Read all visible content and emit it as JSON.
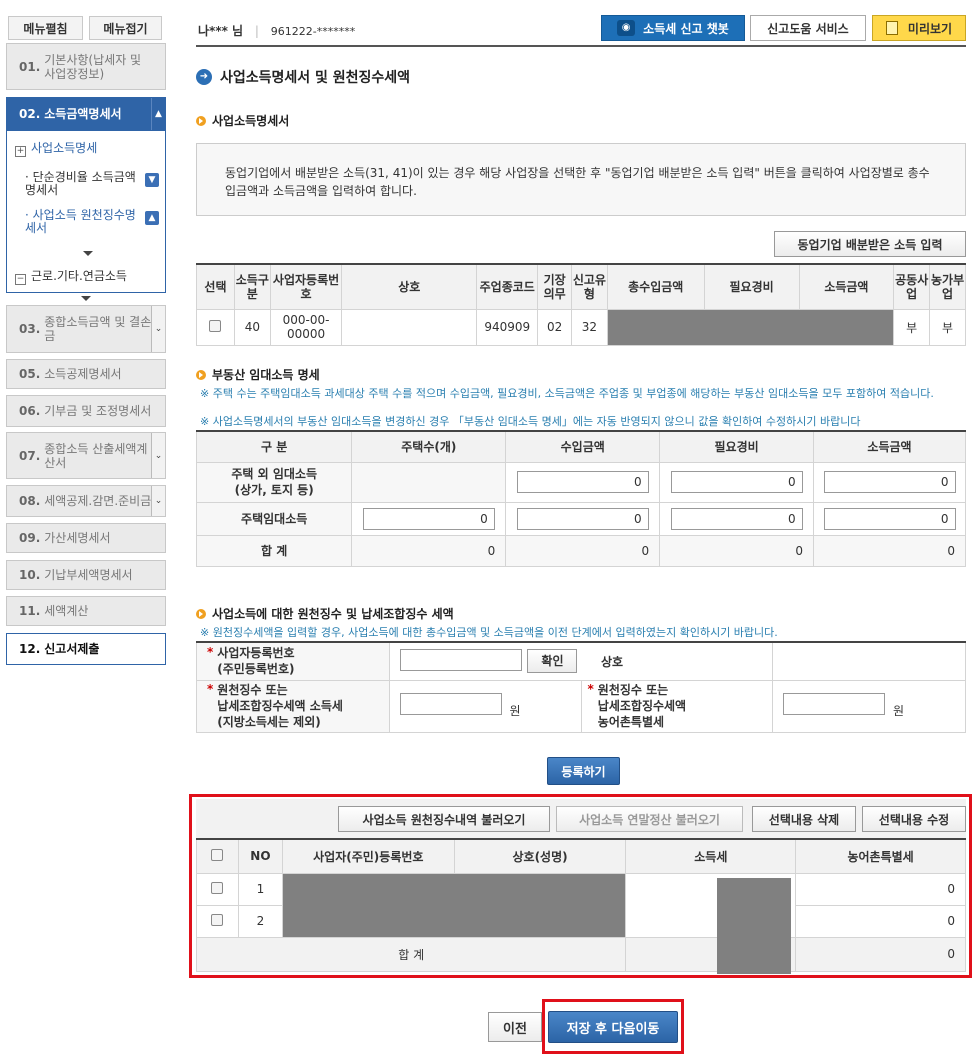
{
  "sidebar": {
    "menu_open": "메뉴펼침",
    "menu_close": "메뉴접기",
    "items": [
      {
        "num": "01.",
        "label": "기본사항(납세자 및\n사업장정보)"
      },
      {
        "num": "02.",
        "label": "소득금액명세서"
      },
      {
        "num": "03.",
        "label": "종합소득금액 및 결손금"
      },
      {
        "num": "05.",
        "label": "소득공제명세서"
      },
      {
        "num": "06.",
        "label": "기부금 및 조정명세서"
      },
      {
        "num": "07.",
        "label": "종합소득 산출세액계산서"
      },
      {
        "num": "08.",
        "label": "세액공제.감면.준비금"
      },
      {
        "num": "09.",
        "label": "가산세명세서"
      },
      {
        "num": "10.",
        "label": "기납부세액명세서"
      },
      {
        "num": "11.",
        "label": "세액계산"
      },
      {
        "num": "12.",
        "label": "신고서제출"
      }
    ],
    "sub": {
      "business": "사업소득명세",
      "simple_rate": "단순경비율 소득금액명세서",
      "withholding": "사업소득 원천징수명세서",
      "labor": "근로.기타.연금소득"
    }
  },
  "header": {
    "user_name": "나*** 님",
    "user_id": "961222-*******",
    "chatbot": "소득세 신고 챗봇",
    "help": "신고도움 서비스",
    "preview": "미리보기"
  },
  "page_title": "사업소득명세서 및 원천징수세액",
  "business": {
    "title": "사업소득명세서",
    "info": "동업기업에서 배분받은 소득(31, 41)이 있는 경우 해당 사업장을 선택한 후 \"동업기업 배분받은 소득 입력\" 버튼을 클릭하여 사업장별로 총수입금액과 소득금액을 입력하여 합니다.",
    "partner_btn": "동업기업 배분받은 소득 입력",
    "columns": [
      "선택",
      "소득구분",
      "사업자등록번호",
      "상호",
      "주업종코드",
      "기장의무",
      "신고유형",
      "총수입금액",
      "필요경비",
      "소득금액",
      "공동사업",
      "농가부업"
    ],
    "row": {
      "type": "40",
      "reg_no": "000-00-00000",
      "name": "",
      "code": "940909",
      "duty": "02",
      "report": "32",
      "joint": "부",
      "farm": "부"
    }
  },
  "rental": {
    "title": "부동산 임대소득 명세",
    "note1": "※ 주택 수는 주택임대소득 과세대상 주택 수를 적으며 수입금액, 필요경비, 소득금액은 주업종 및 부업종에 해당하는 부동산 임대소득을 모두 포함하여 적습니다.",
    "note2": "※ 사업소득명세서의 부동산 임대소득을 변경하신 경우 「부동산 임대소득 명세」에는 자동 반영되지 않으니 값을 확인하여 수정하시기 바랍니다",
    "columns": [
      "구 분",
      "주택수(개)",
      "수입금액",
      "필요경비",
      "소득금액"
    ],
    "rows": [
      {
        "label": "주택 외 임대소득\n(상가, 토지 등)",
        "v1": "0",
        "v2": "0",
        "v3": "0"
      },
      {
        "label": "주택임대소득",
        "houses": "0",
        "v1": "0",
        "v2": "0",
        "v3": "0"
      }
    ],
    "total": {
      "label": "합 계",
      "houses": "0",
      "v1": "0",
      "v2": "0",
      "v3": "0"
    }
  },
  "withholding": {
    "title": "사업소득에 대한 원천징수 및 납세조합징수 세액",
    "note": "※ 원천징수세액을 입력할 경우, 사업소득에 대한 총수입금액 및 소득금액을 이전 단계에서 입력하였는지 확인하시기 바랍니다.",
    "reg_label": "사업자등록번호\n(주민등록번호)",
    "confirm_btn": "확인",
    "name_label": "상호",
    "tax_label": "원천징수 또는\n납세조합징수세액 소득세\n(지방소득세는 제외)",
    "won": "원",
    "rural_label": "원천징수 또는\n납세조합징수세액\n농어촌특별세",
    "register_btn": "등록하기",
    "load_btn": "사업소득 원천징수내역 불러오기",
    "load_year_btn": "사업소득 연말정산 불러오기",
    "delete_btn": "선택내용 삭제",
    "edit_btn": "선택내용 수정",
    "columns": [
      "NO",
      "사업자(주민)등록번호",
      "상호(성명)",
      "소득세",
      "농어촌특별세"
    ],
    "rows": [
      {
        "no": "1",
        "rural": "0"
      },
      {
        "no": "2",
        "rural": "0"
      }
    ],
    "total_label": "합 계",
    "total_rural": "0"
  },
  "footer": {
    "prev": "이전",
    "next": "저장 후 다음이동"
  }
}
